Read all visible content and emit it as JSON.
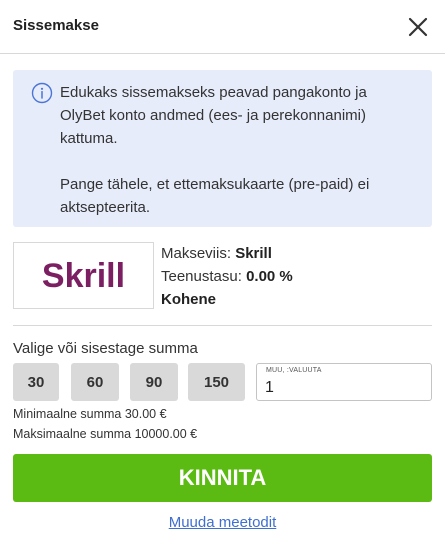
{
  "header": {
    "title": "Sissemakse"
  },
  "info": {
    "paragraph1": "Edukaks sissemakseks peavad pangakonto ja OlyBet konto andmed (ees- ja perekonnanimi) kattuma.",
    "paragraph2": "Pange tähele, et ettemaksukaarte (pre-paid) ei aktsepteerita."
  },
  "method": {
    "logo_text": "Skrill",
    "logo_color": "#7b1f62",
    "method_label": "Makseviis:",
    "method_value": "Skrill",
    "fee_label": "Teenustasu:",
    "fee_value": "0.00 %",
    "timing": "Kohene"
  },
  "amount": {
    "label": "Valige või sisestage summa",
    "presets": [
      "30",
      "60",
      "90",
      "150"
    ],
    "custom_label": "MUU, :VALUUTA",
    "custom_value": "1",
    "min_text": "Minimaalne summa 30.00 €",
    "max_text": "Maksimaalne summa 10000.00 €"
  },
  "confirm": {
    "label": "KINNITA",
    "color": "#5cbb13"
  },
  "change_method": {
    "label": "Muuda meetodit"
  }
}
